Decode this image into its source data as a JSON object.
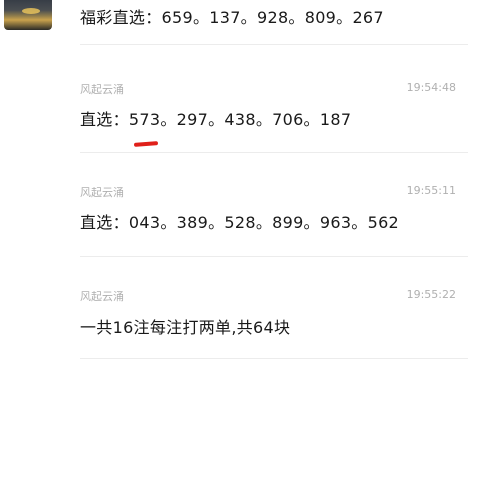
{
  "messages": [
    {
      "sender": "",
      "time": "",
      "text": "福彩直选：659。137。928。809。267"
    },
    {
      "sender": "风起云涌",
      "time": "19:54:48",
      "text": "直选：573。297。438。706。187"
    },
    {
      "sender": "风起云涌",
      "time": "19:55:11",
      "text": "直选：043。389。528。899。963。562"
    },
    {
      "sender": "风起云涌",
      "time": "19:55:22",
      "text": "一共16注每注打两单,共64块"
    }
  ],
  "colors": {
    "annotation_mark": "#e0201a",
    "meta_text": "#b0b0b0",
    "body_text": "#1a1a1a",
    "divider": "#ececec"
  }
}
